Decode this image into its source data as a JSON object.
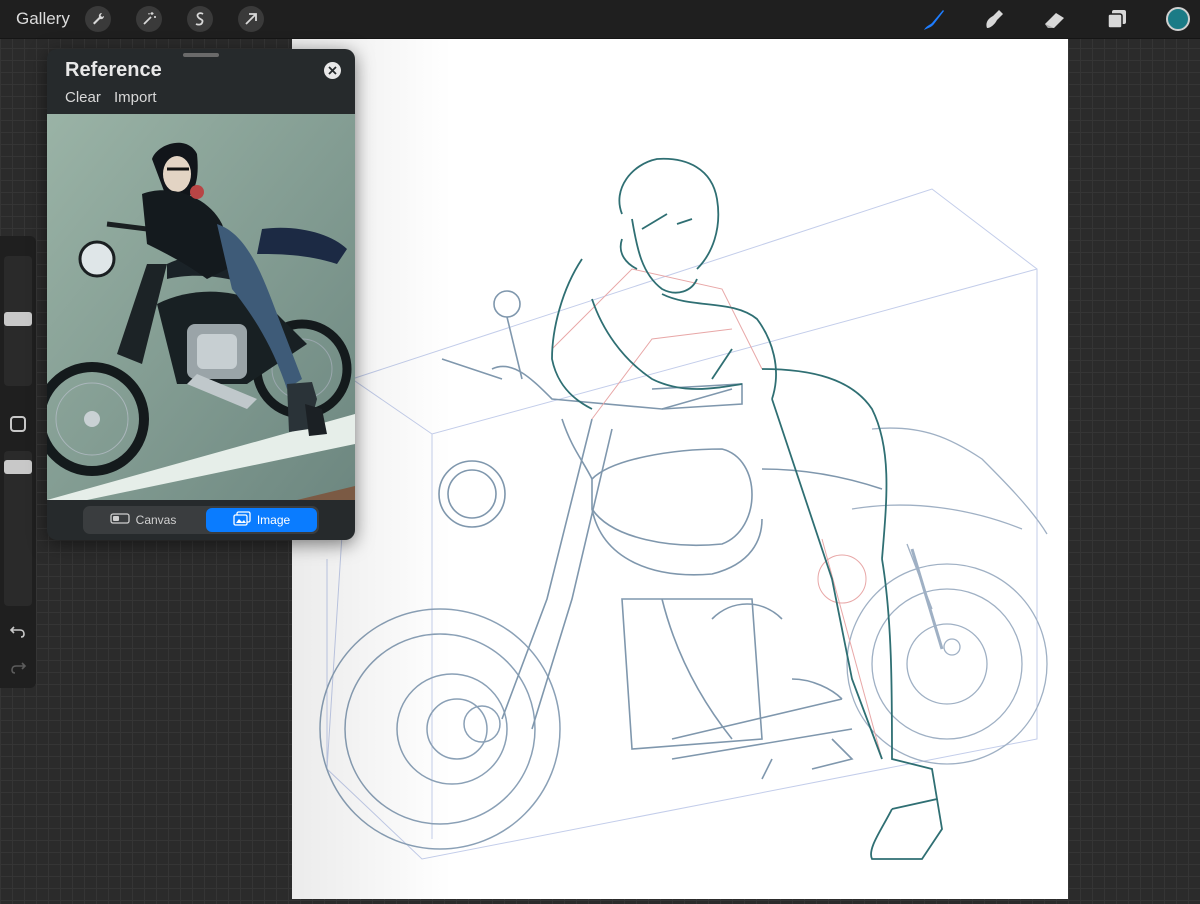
{
  "app": {
    "gallery_label": "Gallery",
    "left_tools": [
      "wrench-icon",
      "magic-wand-icon",
      "selection-icon",
      "transform-arrow-icon"
    ],
    "right_tools": [
      "brush-icon",
      "smudge-icon",
      "eraser-icon",
      "layers-icon"
    ],
    "accent_color": "#0a7cff",
    "current_color": "#1b7b86"
  },
  "reference": {
    "title": "Reference",
    "actions": {
      "clear": "Clear",
      "import": "Import"
    },
    "toggle": {
      "canvas": "Canvas",
      "image": "Image",
      "selected": "Image"
    }
  },
  "sidebar": {
    "controls": [
      "brush-size-slider",
      "modify-button",
      "opacity-slider",
      "undo-icon",
      "redo-icon"
    ]
  }
}
